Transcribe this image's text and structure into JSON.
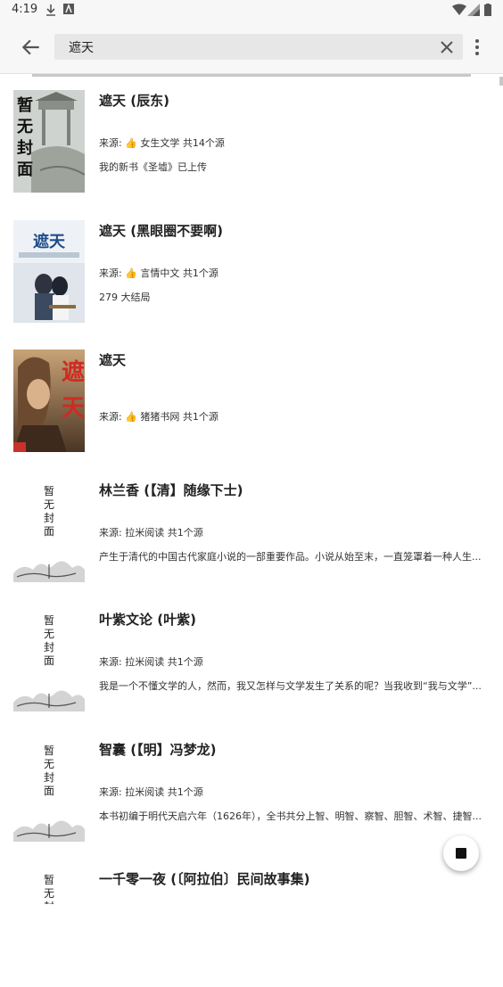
{
  "status_bar": {
    "time": "4:19"
  },
  "search": {
    "query": "遮天"
  },
  "results": [
    {
      "title": "遮天 (辰东)",
      "source": "来源: 👍 女生文学  共14个源",
      "intro": "我的新书《圣墟》已上传",
      "cover_text": "暂无封面",
      "cover_style": "placeholder-dark"
    },
    {
      "title": "遮天 (黑眼圈不要啊)",
      "source": "来源: 👍 言情中文  共1个源",
      "intro": "279 大结局",
      "cover_text": "遮天",
      "cover_style": "photo-blue"
    },
    {
      "title": "遮天",
      "source": "来源: 👍 猪猪书网  共1个源",
      "intro": "",
      "cover_text": "遮天",
      "cover_style": "art-red"
    },
    {
      "title": "林兰香 (【清】随缘下士)",
      "source": "来源: 拉米阅读  共1个源",
      "intro": "产生于清代的中国古代家庭小说的一部重要作品。小说从始至末，一直笼罩着一种人生...",
      "cover_text": "暂无封面",
      "cover_style": "placeholder-ink"
    },
    {
      "title": "叶紫文论 (叶紫)",
      "source": "来源: 拉米阅读  共1个源",
      "intro": "我是一个不懂文学的人，然而，我又怎样与文学发生了关系的呢？当我收到“我与文学”...",
      "cover_text": "暂无封面",
      "cover_style": "placeholder-ink"
    },
    {
      "title": "智囊 (【明】冯梦龙)",
      "source": "来源: 拉米阅读  共1个源",
      "intro": "本书初编于明代天启六年（1626年），全书共分上智、明智、察智、胆智、术智、捷智...",
      "cover_text": "暂无封面",
      "cover_style": "placeholder-ink"
    },
    {
      "title": "一千零一夜 (〔阿拉伯〕民间故事集)",
      "source": "",
      "intro": "",
      "cover_text": "暂无封面",
      "cover_style": "placeholder-ink"
    }
  ]
}
